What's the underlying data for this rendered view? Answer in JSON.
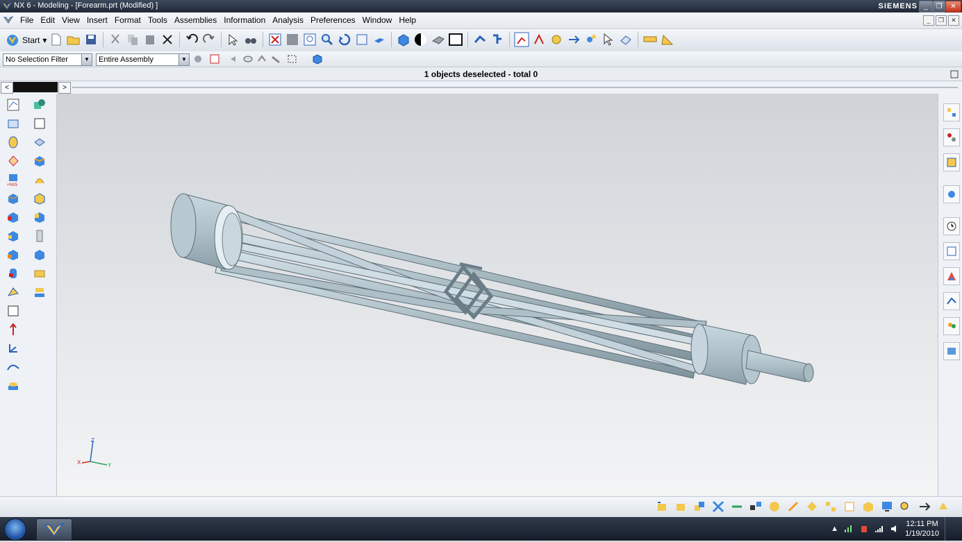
{
  "window": {
    "title": "NX 6 - Modeling - [Forearm.prt (Modified) ]",
    "brand": "SIEMENS",
    "min_label": "_",
    "max_label": "❐",
    "close_label": "✕"
  },
  "menubar": {
    "items": [
      {
        "key": "F",
        "rest": "ile"
      },
      {
        "key": "E",
        "rest": "dit"
      },
      {
        "key": "V",
        "rest": "iew"
      },
      {
        "key": "I",
        "rest": "nsert",
        "pre": ""
      },
      {
        "key": "F",
        "rest": "ormat"
      },
      {
        "key": "T",
        "rest": "ools"
      },
      {
        "key": "A",
        "rest": "ssemblies"
      },
      {
        "key": "I",
        "rest": "nformation"
      },
      {
        "key": "A",
        "rest": "nalysis"
      },
      {
        "key": "P",
        "rest": "references"
      },
      {
        "key": "W",
        "rest": "indow"
      },
      {
        "key": "H",
        "rest": "elp"
      }
    ],
    "labels": [
      "File",
      "Edit",
      "View",
      "Insert",
      "Format",
      "Tools",
      "Assemblies",
      "Information",
      "Analysis",
      "Preferences",
      "Window",
      "Help"
    ]
  },
  "toolbar": {
    "start_label": "Start",
    "start_dropdown": "▾"
  },
  "selection": {
    "filter_value": "No Selection Filter",
    "scope_value": "Entire Assembly",
    "dropdown_arrow": "▼"
  },
  "cue": {
    "message": "1 objects deselected  - total 0"
  },
  "tabs": {
    "left_arrow": "<",
    "right_arrow": ">"
  },
  "triad": {
    "z": "Z",
    "x": "X",
    "y": "Y"
  },
  "taskbar": {
    "time": "12:11 PM",
    "date": "1/19/2010"
  },
  "colors": {
    "part_fill": "#b9cbd4",
    "part_dark": "#7d929c",
    "accent": "#2b61b8"
  }
}
